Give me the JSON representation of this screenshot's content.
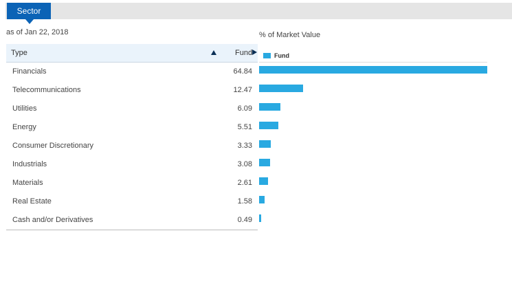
{
  "tabs": [
    {
      "label": "Sector"
    }
  ],
  "as_of": "as of Jan 22, 2018",
  "table": {
    "col_type": "Type",
    "col_fund": "Fund",
    "rows": [
      {
        "type": "Financials",
        "fund": "64.84"
      },
      {
        "type": "Telecommunications",
        "fund": "12.47"
      },
      {
        "type": "Utilities",
        "fund": "6.09"
      },
      {
        "type": "Energy",
        "fund": "5.51"
      },
      {
        "type": "Consumer Discretionary",
        "fund": "3.33"
      },
      {
        "type": "Industrials",
        "fund": "3.08"
      },
      {
        "type": "Materials",
        "fund": "2.61"
      },
      {
        "type": "Real Estate",
        "fund": "1.58"
      },
      {
        "type": "Cash and/or Derivatives",
        "fund": "0.49"
      }
    ]
  },
  "chart_data": {
    "type": "bar",
    "title": "% of Market Value",
    "categories": [
      "Financials",
      "Telecommunications",
      "Utilities",
      "Energy",
      "Consumer Discretionary",
      "Industrials",
      "Materials",
      "Real Estate",
      "Cash and/or Derivatives"
    ],
    "series": [
      {
        "name": "Fund",
        "values": [
          64.84,
          12.47,
          6.09,
          5.51,
          3.33,
          3.08,
          2.61,
          1.58,
          0.49
        ]
      }
    ],
    "color": "#29a9e1",
    "legend": "top-left",
    "grid": false
  },
  "colors": {
    "tab_active": "#0b63b6",
    "header_bg": "#eaf3fb",
    "bar": "#29a9e1"
  },
  "icons": {
    "sort_type": "triangle-up-icon",
    "sort_fund": "triangle-right-icon"
  }
}
